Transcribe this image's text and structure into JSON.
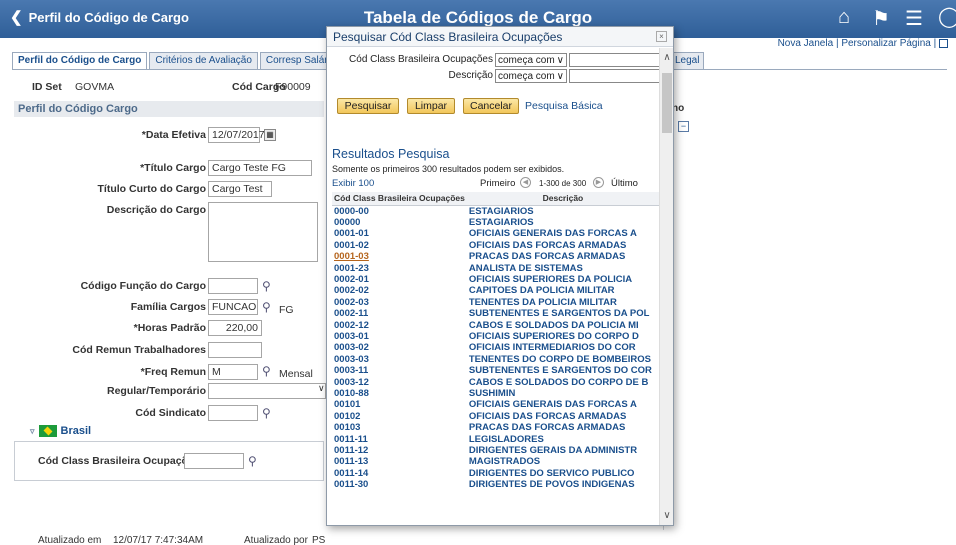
{
  "header": {
    "back_label": "Perfil do Código de Cargo",
    "title": "Tabela de Códigos de Cargo",
    "icons": [
      "home-icon",
      "flag-icon",
      "menu-icon",
      "compass-icon"
    ]
  },
  "top_links": {
    "new_window": "Nova Janela",
    "separator": "|",
    "personalize": "Personalizar Página",
    "separator2": "|"
  },
  "tabs": [
    {
      "label": "Perfil do Código de Cargo",
      "active": true
    },
    {
      "label": "Critérios de Avaliação",
      "active": false
    },
    {
      "label": "Corresp Salários",
      "active": false
    }
  ],
  "legal_tab": "Legal",
  "ids": {
    "setid_label": "ID Set",
    "setid_value": "GOVMA",
    "jobcode_label": "Cód Cargo",
    "jobcode_value": "F90009"
  },
  "section_title": "Perfil do Código Cargo",
  "side_label": "no",
  "form": {
    "effdt_label": "*Data Efetiva",
    "effdt_value": "12/07/2017",
    "calendar_icon": "calendar-icon",
    "title_label": "*Título Cargo",
    "title_value": "Cargo Teste FG",
    "short_title_label": "Título Curto do Cargo",
    "short_title_value": "Cargo Test",
    "descr_label": "Descrição do Cargo",
    "function_label": "Código Função do Cargo",
    "function_value": "",
    "family_label": "Família Cargos",
    "family_value": "FUNCAO",
    "family_descr": "FG",
    "hours_label": "*Horas Padrão",
    "hours_value": "220,00",
    "comp_label": "Cód Remun Trabalhadores",
    "comp_value": "",
    "freq_label": "*Freq Remun",
    "freq_value": "M",
    "freq_descr": "Mensal",
    "regtemp_label": "Regular/Temporário",
    "regtemp_value": "",
    "union_label": "Cód Sindicato",
    "union_value": ""
  },
  "brasil": {
    "label": "Brasil",
    "cbo_label": "Cód Class Brasileira Ocupações",
    "cbo_value": ""
  },
  "footer": {
    "updated_label": "Atualizado em",
    "updated_value": "12/07/17 7:47:34AM",
    "by_label": "Atualizado por",
    "by_value": "PS"
  },
  "modal": {
    "title": "Pesquisar Cód Class Brasileira Ocupações",
    "close_label": "×",
    "field1_label": "Cód Class Brasileira Ocupações",
    "field1_op": "começa com",
    "field1_value": "",
    "field2_label": "Descrição",
    "field2_op": "começa com",
    "field2_value": "",
    "btn_search": "Pesquisar",
    "btn_clear": "Limpar",
    "btn_cancel": "Cancelar",
    "basic_search": "Pesquisa Básica",
    "results_title": "Resultados Pesquisa",
    "results_note": "Somente os primeiros 300 resultados podem ser exibidos.",
    "show_all": "Exibir 100",
    "first": "Primeiro",
    "range": "1-300 de 300",
    "last": "Último",
    "col_code": "Cód Class Brasileira Ocupações",
    "col_descr": "Descrição",
    "rows": [
      {
        "code": "0000-00",
        "descr": "ESTAGIARIOS"
      },
      {
        "code": "00000",
        "descr": "ESTAGIARIOS"
      },
      {
        "code": "0001-01",
        "descr": "OFICIAIS GENERAIS DAS FORCAS A"
      },
      {
        "code": "0001-02",
        "descr": "OFICIAIS DAS FORCAS ARMADAS"
      },
      {
        "code": "0001-03",
        "descr": "PRACAS DAS FORCAS ARMADAS",
        "visited": true
      },
      {
        "code": "0001-23",
        "descr": "ANALISTA DE SISTEMAS"
      },
      {
        "code": "0002-01",
        "descr": "OFICIAIS SUPERIORES DA POLICIA"
      },
      {
        "code": "0002-02",
        "descr": "CAPITOES DA POLICIA MILITAR"
      },
      {
        "code": "0002-03",
        "descr": "TENENTES DA POLICIA MILITAR"
      },
      {
        "code": "0002-11",
        "descr": "SUBTENENTES E SARGENTOS DA POL"
      },
      {
        "code": "0002-12",
        "descr": "CABOS E SOLDADOS DA POLICIA MI"
      },
      {
        "code": "0003-01",
        "descr": "OFICIAIS SUPERIORES DO CORPO D"
      },
      {
        "code": "0003-02",
        "descr": "OFICIAIS INTERMEDIARIOS DO COR"
      },
      {
        "code": "0003-03",
        "descr": "TENENTES DO CORPO DE BOMBEIROS"
      },
      {
        "code": "0003-11",
        "descr": "SUBTENENTES E SARGENTOS DO COR"
      },
      {
        "code": "0003-12",
        "descr": "CABOS E SOLDADOS DO CORPO DE B"
      },
      {
        "code": "0010-88",
        "descr": "SUSHIMIN"
      },
      {
        "code": "00101",
        "descr": "OFICIAIS GENERAIS DAS FORCAS A"
      },
      {
        "code": "00102",
        "descr": "OFICIAIS DAS FORCAS ARMADAS"
      },
      {
        "code": "00103",
        "descr": "PRACAS DAS FORCAS ARMADAS"
      },
      {
        "code": "0011-11",
        "descr": "LEGISLADORES"
      },
      {
        "code": "0011-12",
        "descr": "DIRIGENTES GERAIS DA ADMINISTR"
      },
      {
        "code": "0011-13",
        "descr": "MAGISTRADOS"
      },
      {
        "code": "0011-14",
        "descr": "DIRIGENTES DO SERVICO PUBLICO"
      },
      {
        "code": "0011-30",
        "descr": "DIRIGENTES DE POVOS INDIGENAS"
      }
    ]
  },
  "colors": {
    "header_bg": "#3a6aa3",
    "link": "#1a4f8c",
    "button_bg": "#f2c65a",
    "visited": "#b5651d"
  }
}
